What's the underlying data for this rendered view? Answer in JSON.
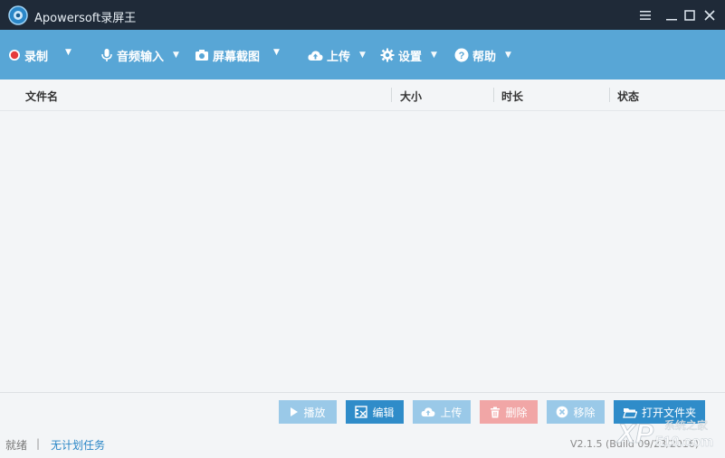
{
  "window": {
    "title": "Apowersoft录屏王"
  },
  "toolbar": {
    "record_label": "录制",
    "audio_label": "音频输入",
    "screenshot_label": "屏幕截图",
    "upload_label": "上传",
    "settings_label": "设置",
    "help_label": "帮助"
  },
  "table": {
    "columns": [
      "文件名",
      "大小",
      "时长",
      "状态"
    ],
    "rows": []
  },
  "actions": {
    "play_label": "播放",
    "edit_label": "编辑",
    "upload_label": "上传",
    "delete_label": "删除",
    "remove_label": "移除",
    "open_folder_label": "打开文件夹"
  },
  "status": {
    "state": "就绪",
    "separator": "|",
    "schedule_link": "无计划任务",
    "version": "V2.1.5 (Build 09/23/2016)"
  },
  "watermark": {
    "brand": "XP",
    "site_cn": "系统之家",
    "domain": "510.com"
  },
  "colors": {
    "titlebar_bg": "#1f2a38",
    "toolbar_bg": "#58a6d6",
    "record_dot": "#e53b3b",
    "play_btn": "#9ac9e8",
    "edit_btn": "#2f8cc9",
    "upload_btn": "#9ac9e8",
    "delete_btn": "#f1a6a6",
    "remove_btn": "#9ac9e8",
    "open_folder_btn": "#2f8cc9"
  }
}
